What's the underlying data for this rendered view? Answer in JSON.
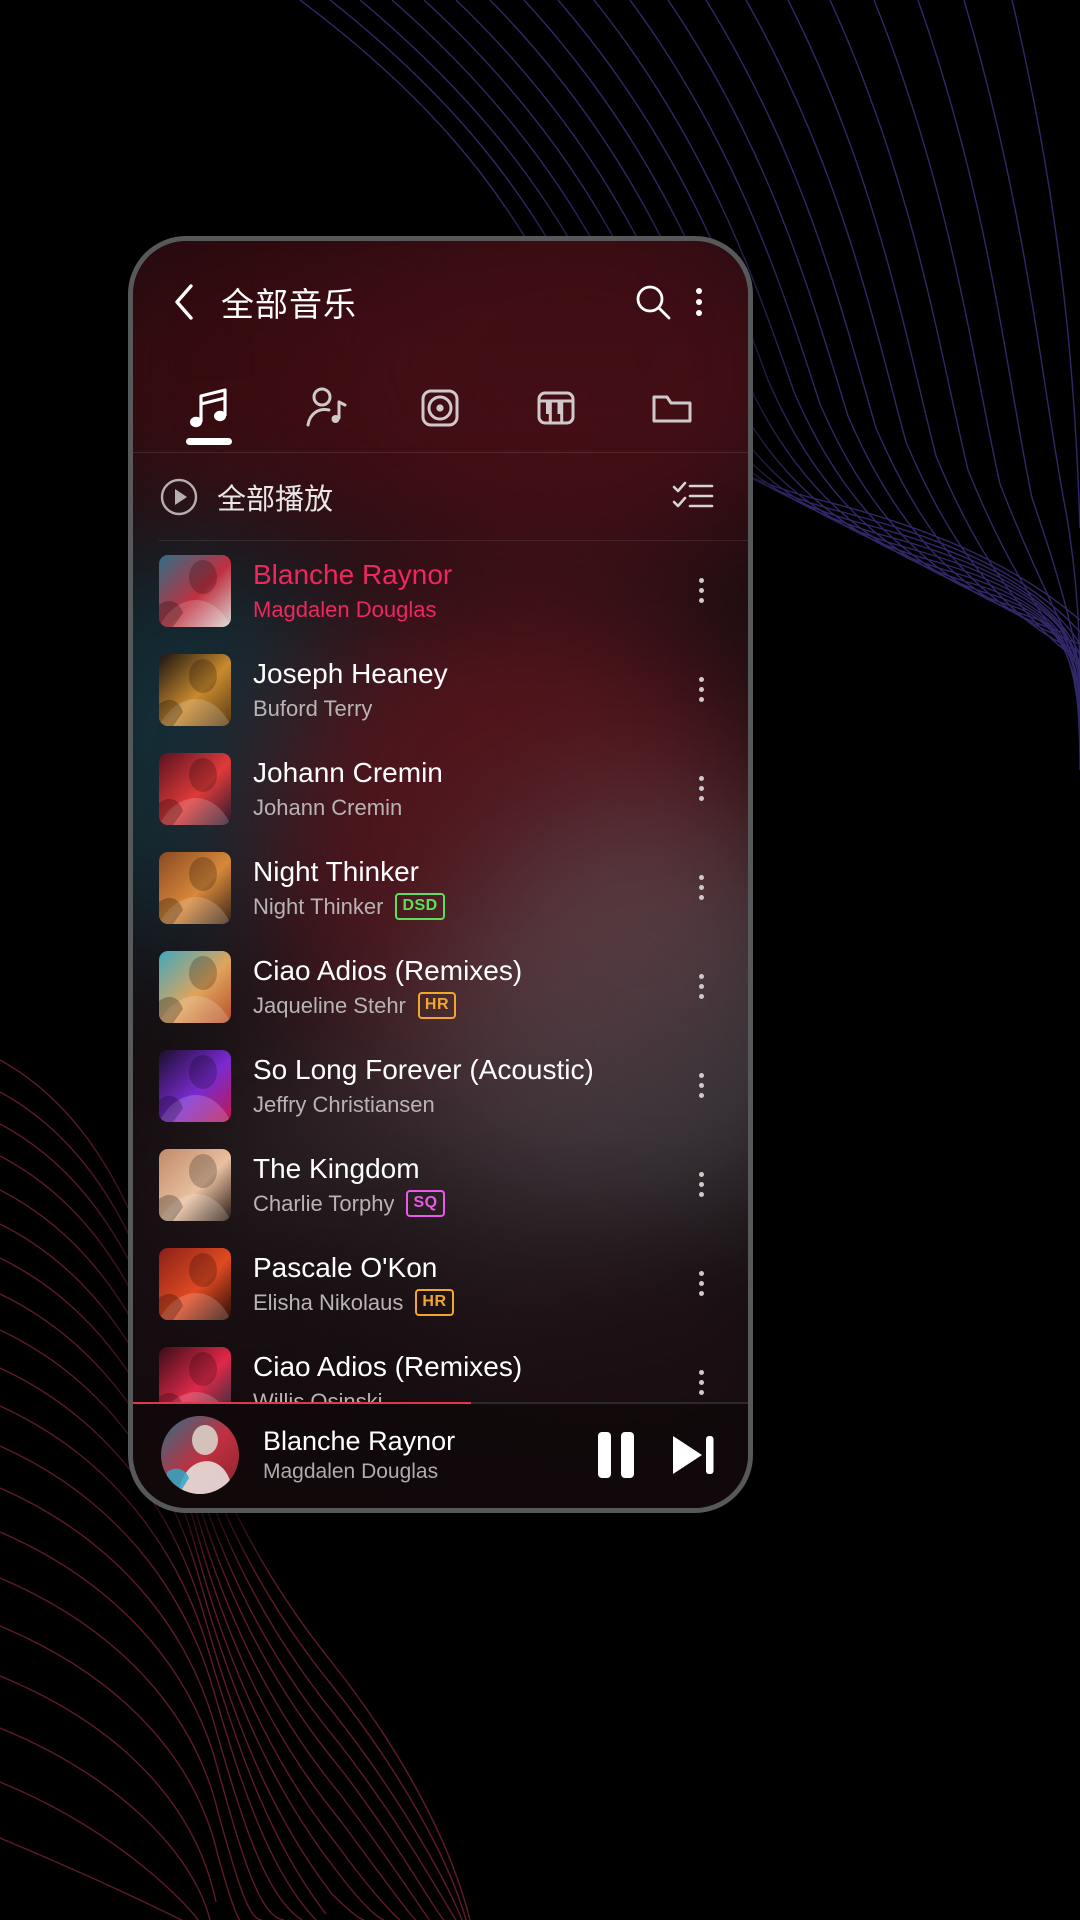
{
  "header": {
    "title": "全部音乐",
    "back_icon": "chevron-left-icon",
    "search_icon": "search-icon",
    "more_icon": "more-vertical-icon"
  },
  "tabs": [
    {
      "name": "songs",
      "icon": "music-note-icon",
      "active": true
    },
    {
      "name": "artists",
      "icon": "artist-icon",
      "active": false
    },
    {
      "name": "albums",
      "icon": "album-disc-icon",
      "active": false
    },
    {
      "name": "genres",
      "icon": "piano-keys-icon",
      "active": false
    },
    {
      "name": "folders",
      "icon": "folder-icon",
      "active": false
    }
  ],
  "play_all": {
    "label": "全部播放",
    "play_icon": "play-circle-icon",
    "select_icon": "checklist-icon"
  },
  "songs": [
    {
      "title": "Blanche Raynor",
      "artist": "Magdalen Douglas",
      "badge": "",
      "playing": true,
      "art": [
        "#2e6f86",
        "#c03040",
        "#d8d5d2"
      ]
    },
    {
      "title": "Joseph Heaney",
      "artist": "Buford Terry",
      "badge": "",
      "playing": false,
      "art": [
        "#1a1412",
        "#c98a2e",
        "#5a3a16"
      ]
    },
    {
      "title": "Johann Cremin",
      "artist": "Johann Cremin",
      "badge": "",
      "playing": false,
      "art": [
        "#5a1220",
        "#e03a3a",
        "#2a1a2e"
      ]
    },
    {
      "title": "Night Thinker",
      "artist": "Night Thinker",
      "badge": "DSD",
      "playing": false,
      "art": [
        "#8a4a22",
        "#d8883a",
        "#3a2418"
      ]
    },
    {
      "title": "Ciao Adios (Remixes)",
      "artist": "Jaqueline Stehr",
      "badge": "HR",
      "playing": false,
      "art": [
        "#3fa8bd",
        "#e0a45c",
        "#b8502c"
      ]
    },
    {
      "title": "So Long Forever (Acoustic)",
      "artist": "Jeffry Christiansen",
      "badge": "",
      "playing": false,
      "art": [
        "#1a0f2e",
        "#7a2ad0",
        "#c01850"
      ]
    },
    {
      "title": "The Kingdom",
      "artist": "Charlie Torphy",
      "badge": "SQ",
      "playing": false,
      "art": [
        "#c08a6a",
        "#e8c0a0",
        "#2a1a14"
      ]
    },
    {
      "title": "Pascale O'Kon",
      "artist": "Elisha Nikolaus",
      "badge": "HR",
      "playing": false,
      "art": [
        "#8a2018",
        "#e04a22",
        "#2a0c08"
      ]
    },
    {
      "title": "Ciao Adios (Remixes)",
      "artist": "Willis Osinski",
      "badge": "",
      "playing": false,
      "art": [
        "#3a0e18",
        "#e0284a",
        "#20303a"
      ]
    }
  ],
  "row_more_icon": "more-vertical-icon",
  "mini_player": {
    "title": "Blanche Raynor",
    "artist": "Magdalen Douglas",
    "pause_icon": "pause-icon",
    "next_icon": "skip-next-icon",
    "progress_percent": 55
  },
  "colors": {
    "accent_pink": "#f0265c",
    "badge_dsd": "#5ce05c",
    "badge_hr": "#f0a72b",
    "badge_sq": "#e85ae8",
    "progress": "#e0344f"
  }
}
